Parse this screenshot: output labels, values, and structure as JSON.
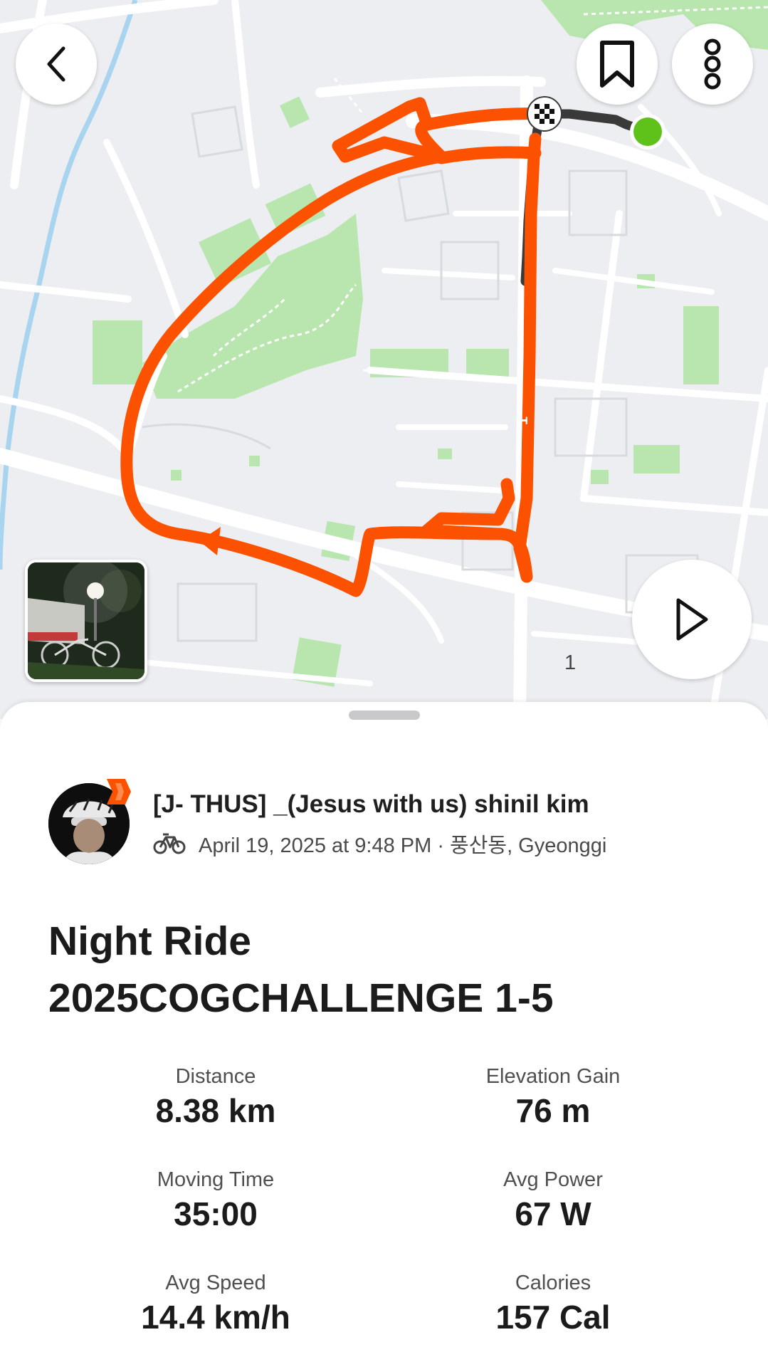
{
  "map": {
    "lap_marker_bottom": "1",
    "lap_marker_route": "1",
    "colors": {
      "route": "#fc5200",
      "route_start": "#3a3a3a",
      "start_dot": "#5fc21a",
      "park": "#b8e6ae",
      "background": "#eceef1",
      "road": "#ffffff",
      "water": "#a8d4f0"
    }
  },
  "toolbar": {
    "back_icon": "chevron-left-icon",
    "bookmark_icon": "bookmark-icon",
    "more_icon": "more-vertical-icon",
    "play_icon": "play-icon"
  },
  "activity": {
    "athlete_name": "[J- THUS] _(Jesus with us) shinil kim",
    "sport_icon": "bike-icon",
    "meta": "April 19, 2025 at 9:48 PM · 풍산동, Gyeonggi",
    "title_line1": "Night Ride",
    "title_line2": "2025COGCHALLENGE 1-5"
  },
  "stats": [
    {
      "label": "Distance",
      "value": "8.38 km"
    },
    {
      "label": "Elevation Gain",
      "value": "76 m"
    },
    {
      "label": "Moving Time",
      "value": "35:00"
    },
    {
      "label": "Avg Power",
      "value": "67 W"
    },
    {
      "label": "Avg Speed",
      "value": "14.4 km/h"
    },
    {
      "label": "Calories",
      "value": "157 Cal"
    }
  ]
}
